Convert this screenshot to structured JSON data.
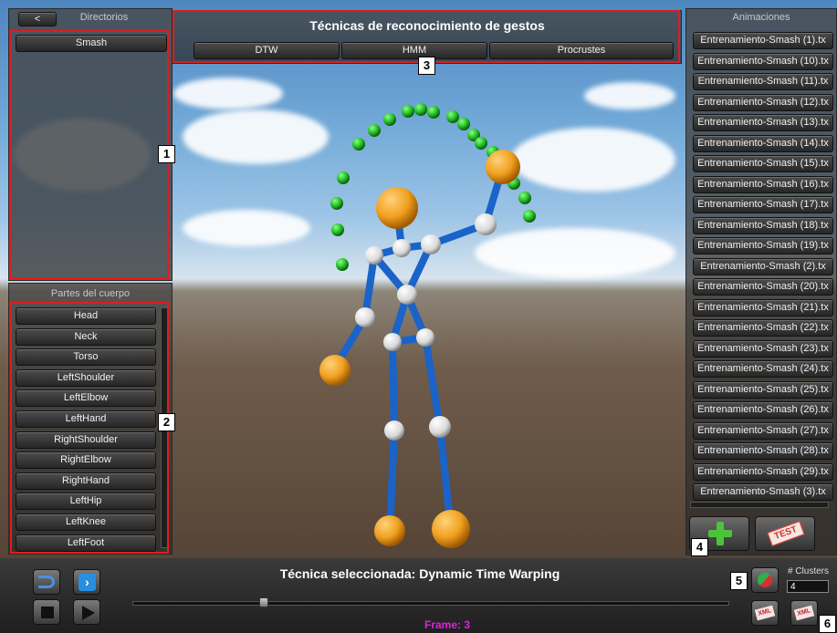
{
  "directories": {
    "back_label": "<",
    "title": "Directorios",
    "items": [
      "Smash"
    ]
  },
  "body_parts": {
    "title": "Partes del cuerpo",
    "items": [
      "Head",
      "Neck",
      "Torso",
      "LeftShoulder",
      "LeftElbow",
      "LeftHand",
      "RightShoulder",
      "RightElbow",
      "RightHand",
      "LeftHip",
      "LeftKnee",
      "LeftFoot"
    ]
  },
  "techniques": {
    "title": "Técnicas de reconocimiento de gestos",
    "buttons": [
      "DTW",
      "HMM",
      "Procrustes"
    ]
  },
  "animations": {
    "title": "Animaciones",
    "items": [
      "Entrenamiento-Smash (1).tx",
      "Entrenamiento-Smash (10).tx",
      "Entrenamiento-Smash (11).tx",
      "Entrenamiento-Smash (12).tx",
      "Entrenamiento-Smash (13).tx",
      "Entrenamiento-Smash (14).tx",
      "Entrenamiento-Smash (15).tx",
      "Entrenamiento-Smash (16).tx",
      "Entrenamiento-Smash (17).tx",
      "Entrenamiento-Smash (18).tx",
      "Entrenamiento-Smash (19).tx",
      "Entrenamiento-Smash (2).tx",
      "Entrenamiento-Smash (20).tx",
      "Entrenamiento-Smash (21).tx",
      "Entrenamiento-Smash (22).tx",
      "Entrenamiento-Smash (23).tx",
      "Entrenamiento-Smash (24).tx",
      "Entrenamiento-Smash (25).tx",
      "Entrenamiento-Smash (26).tx",
      "Entrenamiento-Smash (27).tx",
      "Entrenamiento-Smash (28).tx",
      "Entrenamiento-Smash (29).tx",
      "Entrenamiento-Smash (3).tx"
    ]
  },
  "actions": {
    "add_icon": "plus-icon",
    "test_label": "TEST"
  },
  "status": {
    "selected_technique": "Técnica seleccionada: Dynamic Time Warping",
    "frame": "Frame: 3",
    "slider_position": 0.22
  },
  "clusters": {
    "label": "# Clusters",
    "value": "4"
  },
  "xml_label": "XML",
  "annotations": [
    "1",
    "2",
    "3",
    "4",
    "5",
    "6"
  ],
  "colors": {
    "highlight_red": "#e31b1b",
    "frame_text": "#e020e0",
    "joint_orange": "#f0a020",
    "trajectory_green": "#22bb22",
    "bone_blue": "#1a63c8"
  }
}
